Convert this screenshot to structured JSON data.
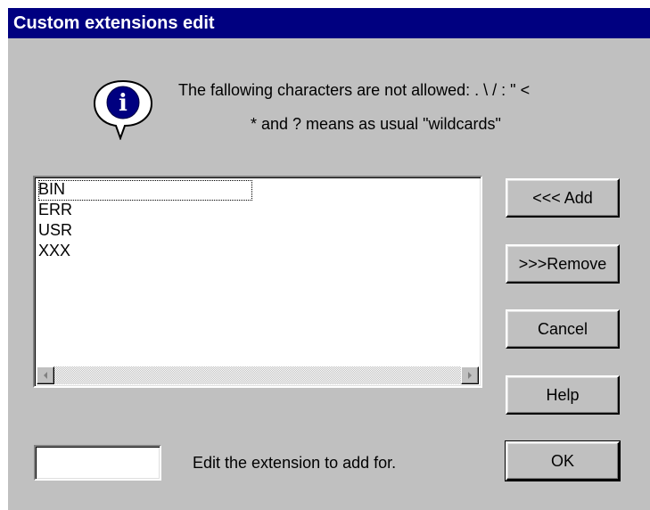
{
  "window": {
    "title": "Custom extensions edit"
  },
  "message": {
    "line1": "The fallowing characters are not allowed: . \\ / : \" <",
    "line2": "* and ? means as usual \"wildcards\""
  },
  "icon": {
    "name": "info-icon",
    "glyph": "i",
    "color": "#000080"
  },
  "extensions": {
    "items": [
      "BIN",
      "ERR",
      "USR",
      "XXX"
    ],
    "focused_index": 0
  },
  "buttons": {
    "add": "<<< Add",
    "remove": ">>>Remove",
    "cancel": "Cancel",
    "help": "Help",
    "ok": "OK"
  },
  "edit": {
    "value": "",
    "label": "Edit the extension to add for."
  },
  "colors": {
    "dialog": "#c0c0c0",
    "titlebar": "#000080",
    "titletext": "#ffffff"
  }
}
